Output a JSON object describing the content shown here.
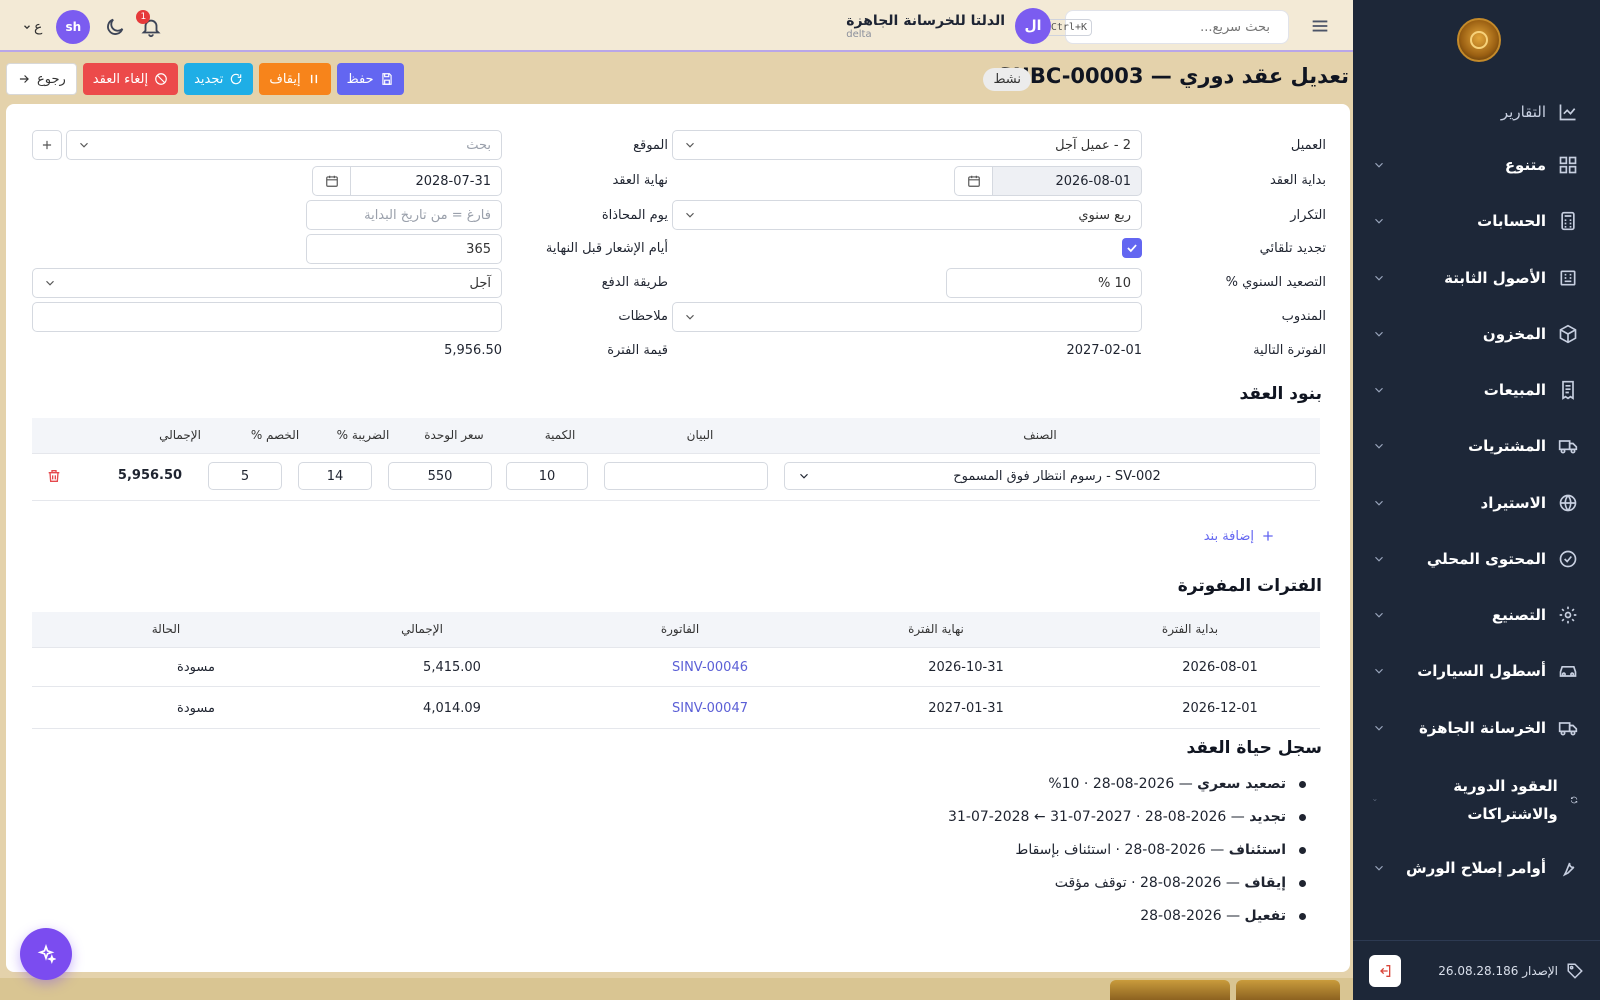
{
  "sidebar": {
    "items": [
      {
        "label": "التقارير",
        "icon": "chart-icon"
      },
      {
        "label": "متنوع",
        "icon": "grid-icon"
      },
      {
        "label": "الحسابات",
        "icon": "calculator-icon"
      },
      {
        "label": "الأصول الثابتة",
        "icon": "building-icon"
      },
      {
        "label": "المخزون",
        "icon": "box-icon"
      },
      {
        "label": "المبيعات",
        "icon": "receipt-icon"
      },
      {
        "label": "المشتريات",
        "icon": "truck-icon"
      },
      {
        "label": "الاستيراد",
        "icon": "globe-icon"
      },
      {
        "label": "المحتوى المحلي",
        "icon": "check-circle-icon"
      },
      {
        "label": "التصنيع",
        "icon": "cog-icon"
      },
      {
        "label": "أسطول السيارات",
        "icon": "car-icon"
      },
      {
        "label": "الخرسانة الجاهزة",
        "icon": "mixer-truck-icon"
      },
      {
        "label": "العقود الدورية والاشتراكات",
        "icon": "refresh-icon"
      },
      {
        "label": "أوامر إصلاح الورش",
        "icon": "wrench-icon"
      }
    ],
    "version": "الإصدار 26.08.28.186"
  },
  "topbar": {
    "search_placeholder": "بحث سريع...",
    "search_shortcut": "Ctrl+K",
    "company_avatar": "ال",
    "company_name": "الدلتا للخرسانة الجاهزة",
    "company_code": "delta",
    "user_initials": "sh",
    "notification_count": "1",
    "lang": "ع"
  },
  "page": {
    "title": "تعديل عقد دوري — SUBC-00003",
    "status": "نشط",
    "actions": {
      "save": "حفظ",
      "pause": "إيقاف",
      "renew": "تجديد",
      "cancel": "إلغاء العقد",
      "back": "رجوع"
    }
  },
  "form": {
    "customer_label": "العميل",
    "customer_value": "2 - عميل آجل",
    "site_label": "الموقع",
    "site_placeholder": "بحث",
    "start_label": "بداية العقد",
    "start_value": "2026-08-01",
    "end_label": "نهاية العقد",
    "end_value": "2028-07-31",
    "frequency_label": "التكرار",
    "frequency_value": "ربع سنوي",
    "billing_day_label": "يوم المحاذاة",
    "billing_day_placeholder": "فارغ = من تاريخ البداية",
    "auto_renew_label": "تجديد تلقائي",
    "notice_days_label": "أيام الإشعار قبل النهاية",
    "notice_days_value": "365",
    "escalation_label": "التصعيد السنوي %",
    "escalation_value": "10 %",
    "payment_label": "طريقة الدفع",
    "payment_value": "آجل",
    "rep_label": "المندوب",
    "notes_label": "ملاحظات",
    "next_invoice_label": "الفوترة التالية",
    "next_invoice_value": "2027-02-01",
    "period_value_label": "قيمة الفترة",
    "period_value": "5,956.50"
  },
  "lines": {
    "title": "بنود العقد",
    "headers": {
      "item": "الصنف",
      "desc": "البيان",
      "qty": "الكمية",
      "price": "سعر الوحدة",
      "tax": "الضريبة %",
      "discount": "الخصم %",
      "total": "الإجمالي"
    },
    "rows": [
      {
        "item": "SV-002 - رسوم انتظار فوق المسموح",
        "desc": "",
        "qty": "10",
        "price": "550",
        "tax": "14",
        "discount": "5",
        "total": "5,956.50"
      }
    ],
    "add_label": "إضافة بند"
  },
  "periods": {
    "title": "الفترات المفوترة",
    "headers": {
      "start": "بداية الفترة",
      "end": "نهاية الفترة",
      "invoice": "الفاتورة",
      "total": "الإجمالي",
      "status": "الحالة"
    },
    "rows": [
      {
        "start": "2026-08-01",
        "end": "2026-10-31",
        "invoice": "SINV-00046",
        "total": "5,415.00",
        "status": "مسودة"
      },
      {
        "start": "2026-12-01",
        "end": "2027-01-31",
        "invoice": "SINV-00047",
        "total": "4,014.09",
        "status": "مسودة"
      }
    ]
  },
  "lifecycle": {
    "title": "سجل حياة العقد",
    "events": [
      {
        "type": "تصعيد سعري",
        "detail": " — 2026-08-28 · 10%"
      },
      {
        "type": "تجديد",
        "detail": " — 2026-08-28 · 2027-07-31 ← 2028-07-31"
      },
      {
        "type": "استئناف",
        "detail": " — 2026-08-28 · استئناف بإسقاط"
      },
      {
        "type": "إيقاف",
        "detail": " — 2026-08-28 · توقف مؤقت"
      },
      {
        "type": "تفعيل",
        "detail": " — 2026-08-28"
      }
    ]
  },
  "colors": {
    "accent": "#6366f1",
    "sidebar": "#1d2738",
    "danger": "#ec4a4a",
    "info": "#1faee6",
    "warning": "#f7841b"
  }
}
